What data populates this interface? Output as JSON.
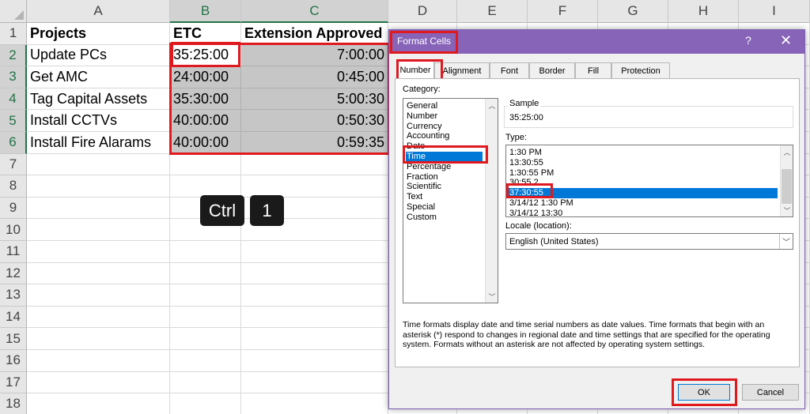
{
  "sheet": {
    "columns": [
      "A",
      "B",
      "C",
      "D",
      "E",
      "F",
      "G",
      "H",
      "I"
    ],
    "rows": [
      "1",
      "2",
      "3",
      "4",
      "5",
      "6",
      "7",
      "8",
      "9",
      "10",
      "11",
      "12",
      "13",
      "14",
      "15",
      "16",
      "17",
      "18"
    ],
    "header": {
      "a": "Projects",
      "b": "ETC",
      "c": "Extension Approved"
    },
    "data": [
      {
        "a": "Update PCs",
        "b": "35:25:00",
        "c": "7:00:00"
      },
      {
        "a": "Get AMC",
        "b": "24:00:00",
        "c": "0:45:00"
      },
      {
        "a": "Tag Capital Assets",
        "b": "35:30:00",
        "c": "5:00:30"
      },
      {
        "a": "Install CCTVs",
        "b": "40:00:00",
        "c": "0:50:30"
      },
      {
        "a": "Install Fire Alarams",
        "b": "40:00:00",
        "c": "0:59:35"
      }
    ],
    "shortcut_keys": [
      "Ctrl",
      "1"
    ]
  },
  "dialog": {
    "title": "Format Cells",
    "help": "?",
    "close": "✕",
    "tabs": [
      "Number",
      "Alignment",
      "Font",
      "Border",
      "Fill",
      "Protection"
    ],
    "category_label": "Category:",
    "categories": [
      "General",
      "Number",
      "Currency",
      "Accounting",
      "Date",
      "Time",
      "Percentage",
      "Fraction",
      "Scientific",
      "Text",
      "Special",
      "Custom"
    ],
    "selected_category": "Time",
    "sample_label": "Sample",
    "sample_value": "35:25:00",
    "type_label": "Type:",
    "types": [
      "1:30 PM",
      "13:30:55",
      "1:30:55 PM",
      "30:55.2",
      "37:30:55",
      "3/14/12 1:30 PM",
      "3/14/12 13:30"
    ],
    "selected_type": "37:30:55",
    "locale_label": "Locale (location):",
    "locale_value": "English (United States)",
    "description": "Time formats display date and time serial numbers as date values.  Time formats that begin with an asterisk (*) respond to changes in regional date and time settings that are specified for the operating system. Formats without an asterisk are not affected by operating system settings.",
    "ok_label": "OK",
    "cancel_label": "Cancel"
  },
  "colors": {
    "accent": "#8764b8",
    "highlight": "#e0191f",
    "selection": "#0078d7",
    "excel_green": "#217346"
  }
}
